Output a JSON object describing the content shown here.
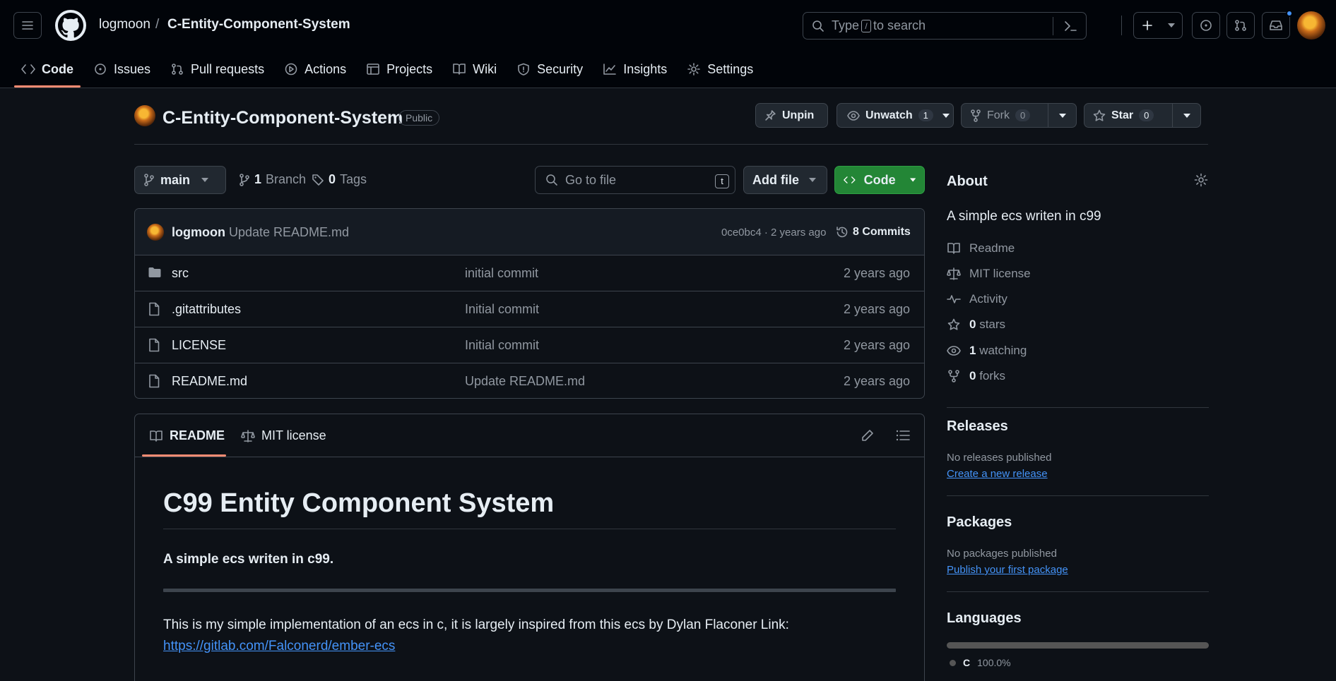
{
  "header": {
    "owner": "logmoon",
    "separator": "/",
    "repo": "C-Entity-Component-System",
    "search_pre": "Type",
    "search_key": "/",
    "search_post": "to search"
  },
  "repo_nav": [
    {
      "label": "Code",
      "icon": "code-icon",
      "active": true
    },
    {
      "label": "Issues",
      "icon": "issue-icon"
    },
    {
      "label": "Pull requests",
      "icon": "pull-request-icon"
    },
    {
      "label": "Actions",
      "icon": "play-icon"
    },
    {
      "label": "Projects",
      "icon": "table-icon"
    },
    {
      "label": "Wiki",
      "icon": "book-icon"
    },
    {
      "label": "Security",
      "icon": "shield-icon"
    },
    {
      "label": "Insights",
      "icon": "graph-icon"
    },
    {
      "label": "Settings",
      "icon": "gear-icon"
    }
  ],
  "repo_head": {
    "title": "C-Entity-Component-System",
    "visibility": "Public",
    "unpin": "Unpin",
    "unwatch": "Unwatch",
    "watch_count": "1",
    "fork": "Fork",
    "fork_count": "0",
    "star": "Star",
    "star_count": "0"
  },
  "toolbar": {
    "branch": "main",
    "branch_count": "1",
    "branch_label": "Branch",
    "tag_count": "0",
    "tag_label": "Tags",
    "goto_placeholder": "Go to file",
    "goto_key": "t",
    "add_file": "Add file",
    "code": "Code"
  },
  "latest_commit": {
    "author": "logmoon",
    "message": "Update README.md",
    "meta": "0ce0bc4 · 2 years ago",
    "commits": "8 Commits"
  },
  "files": [
    {
      "type": "folder",
      "name": "src",
      "message": "initial commit",
      "date": "2 years ago"
    },
    {
      "type": "file",
      "name": ".gitattributes",
      "message": "Initial commit",
      "date": "2 years ago"
    },
    {
      "type": "file",
      "name": "LICENSE",
      "message": "Initial commit",
      "date": "2 years ago"
    },
    {
      "type": "file",
      "name": "README.md",
      "message": "Update README.md",
      "date": "2 years ago"
    }
  ],
  "readme": {
    "tab_readme": "README",
    "tab_license": "MIT license",
    "h1": "C99 Entity Component System",
    "subtitle": "A simple ecs writen in c99.",
    "para": "This is my simple implementation of an ecs in c, it is largely inspired from this ecs by Dylan Flaconer Link:",
    "link": "https://gitlab.com/Falconerd/ember-ecs"
  },
  "sidebar": {
    "about_title": "About",
    "description": "A simple ecs writen in c99",
    "readme": "Readme",
    "license": "MIT license",
    "activity": "Activity",
    "stars_count": "0",
    "stars_label": "stars",
    "watching_count": "1",
    "watching_label": "watching",
    "forks_count": "0",
    "forks_label": "forks",
    "releases_title": "Releases",
    "releases_none": "No releases published",
    "releases_link": "Create a new release",
    "packages_title": "Packages",
    "packages_none": "No packages published",
    "packages_link": "Publish your first package",
    "languages_title": "Languages",
    "lang_name": "C",
    "lang_pct": "100.0%",
    "lang_color": "#555555"
  },
  "colors": {
    "accent_underline": "#fd8c73",
    "link": "#4493f8",
    "code_button": "#238636",
    "bg": "#0d1117"
  }
}
